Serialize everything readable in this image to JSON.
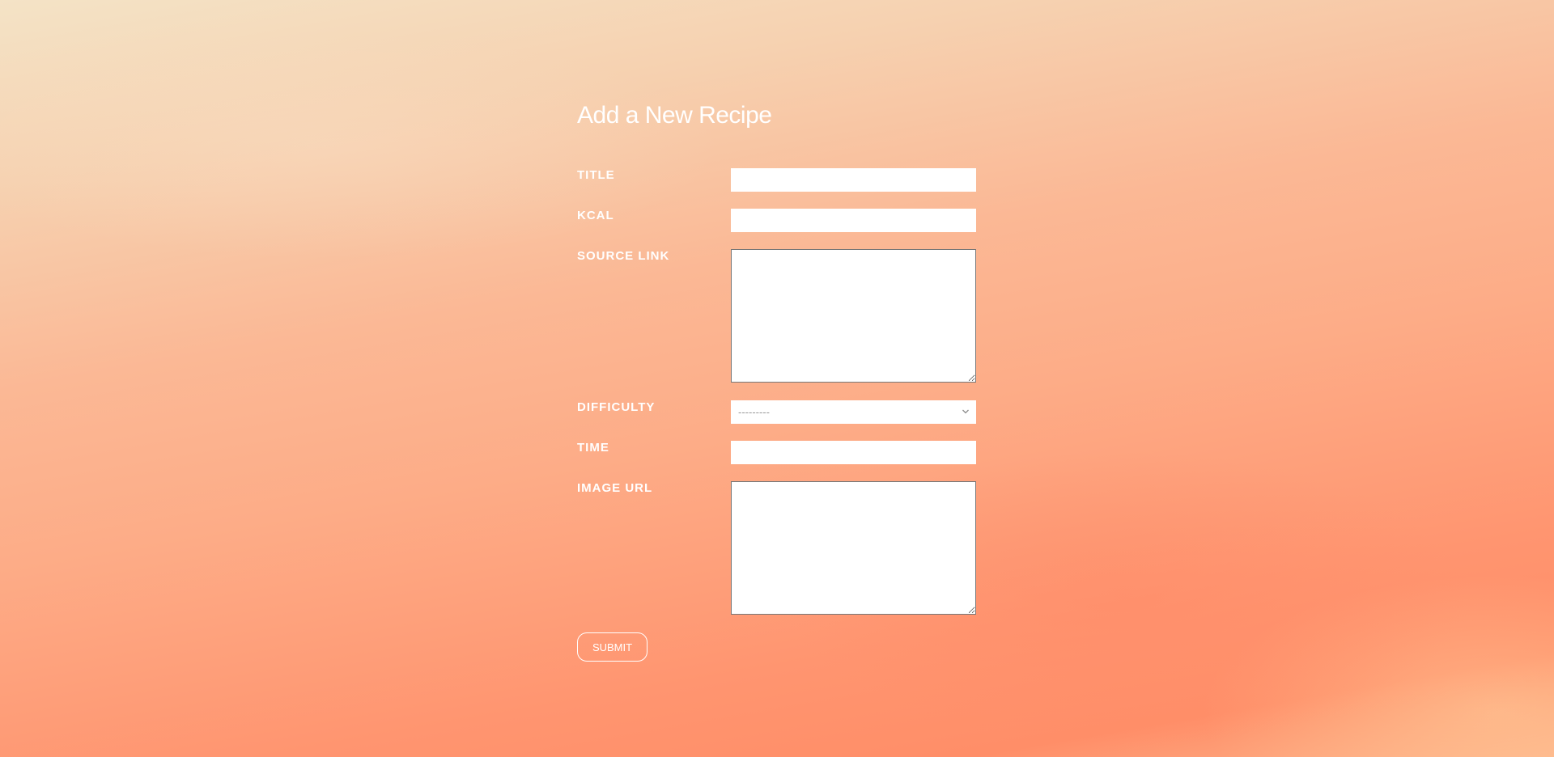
{
  "page": {
    "title": "Add a New Recipe"
  },
  "form": {
    "fields": {
      "title": {
        "label": "TITLE",
        "value": ""
      },
      "kcal": {
        "label": "KCAL",
        "value": ""
      },
      "source_link": {
        "label": "SOURCE LINK",
        "value": ""
      },
      "difficulty": {
        "label": "DIFFICULTY",
        "selected": "---------"
      },
      "time": {
        "label": "TIME",
        "value": ""
      },
      "image_url": {
        "label": "IMAGE URL",
        "value": ""
      }
    },
    "submit_label": "SUBMIT"
  },
  "icons": {
    "difficulty_dropdown": "chevron-down-icon"
  },
  "colors": {
    "background_top": "#f4e3c6",
    "background_bottom": "#ff8e68",
    "text": "#ffffff",
    "field_bg": "#ffffff",
    "placeholder": "#9a9a9a"
  }
}
